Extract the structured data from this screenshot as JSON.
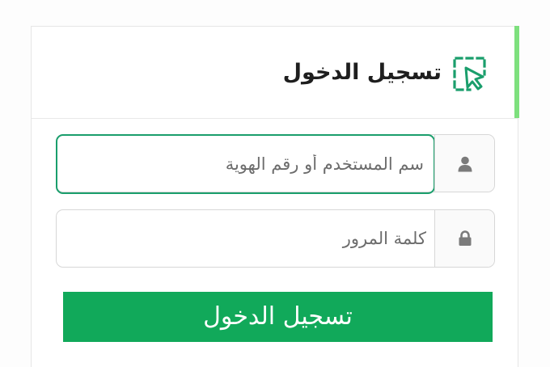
{
  "header": {
    "title": "تسجيل الدخول",
    "icon": "cursor-select-icon",
    "accent_color": "#7ee07e"
  },
  "form": {
    "username": {
      "placeholder": "سم المستخدم أو رقم الهوية",
      "value": "",
      "icon": "user-icon"
    },
    "password": {
      "placeholder": "كلمة المرور",
      "value": "",
      "icon": "lock-icon"
    },
    "submit_label": "تسجيل الدخول",
    "submit_color": "#11a95a",
    "focus_color": "#1a9e6c"
  }
}
